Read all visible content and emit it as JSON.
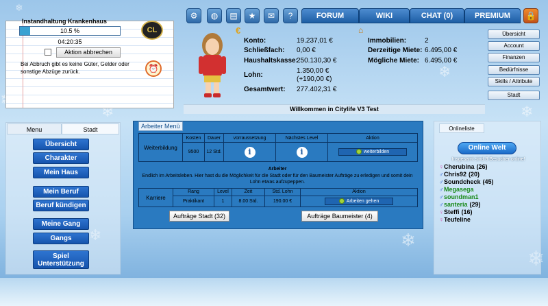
{
  "top_nav": {
    "tabs": [
      "FORUM",
      "WIKI",
      "CHAT (0)",
      "PREMIUM"
    ]
  },
  "task": {
    "title": "Instandhaltung Krankenhaus",
    "progress_text": "10.5 %",
    "progress_fraction": 0.105,
    "time_left": "04:20:35",
    "cancel_button": "Aktion abbrechen",
    "note": "Bei Abbruch gibt es keine Güter, Gelder oder sonstige Abzüge zurück.",
    "logo_text": "CL"
  },
  "status": {
    "konto_label": "Konto:",
    "konto": "19.237,01 €",
    "schliess_label": "Schließfach:",
    "schliess": "0,00 €",
    "haushalt_label": "Haushaltskasse:",
    "haushalt": "250.130,30 €",
    "lohn_label": "Lohn:",
    "lohn": "1.350,00 €",
    "lohn_extra": "(+190,00 €)",
    "gesamt_label": "Gesamtwert:",
    "gesamt": "277.402,31 €",
    "immo_label": "Immobilien:",
    "immo": "2",
    "miete_label": "Derzeitige Miete:",
    "miete": "6.495,00 €",
    "moeglich_label": "Mögliche Miete:",
    "moeglich": "6.495,00 €"
  },
  "welcome": "Willkommen in Citylife V3 Test",
  "right_menu": [
    "Übersicht",
    "Account",
    "Finanzen",
    "Bedürfnisse",
    "Skills / Attribute",
    "Stadt"
  ],
  "left_tabs": [
    "Menu",
    "Stadt"
  ],
  "left_menu": {
    "uebersicht": "Übersicht",
    "charakter": "Charakter",
    "haus": "Mein Haus",
    "beruf": "Mein Beruf",
    "kuendigen": "Beruf kündigen",
    "gang": "Meine Gang",
    "gangs": "Gangs",
    "spiel": "Spiel Unterstützung"
  },
  "arbeiter": {
    "tab": "Arbeiter Menü",
    "weiter": {
      "row_label": "Weiterbildung",
      "headers": [
        "Kosten",
        "Dauer",
        "vorraussetzung",
        "Nächstes Level",
        "Aktion"
      ],
      "kosten": "9500",
      "dauer": "12 Std.",
      "action": "weiterbilden"
    },
    "section_title": "Arbeiter",
    "section_text": "Endlich im Arbeitsleben. Hier hast du die Möglichkeit für die Stadt oder für den Baumeister Aufträge zu erledigen und somit dein Lohn etwas aufzupeppen.",
    "karriere": {
      "row_label": "Karriere",
      "headers": [
        "Rang",
        "Level",
        "Zeit",
        "Std. Lohn",
        "Aktion"
      ],
      "rang": "Praktikant",
      "level": "1",
      "zeit": "8.00 Std.",
      "lohn": "190.00 €",
      "action": "Arbeiten gehen"
    },
    "stadt_button": "Aufträge Stadt  (32)",
    "baumeister_button": "Aufträge Baumeister (4)"
  },
  "online": {
    "tab": "Onlineliste",
    "world_button": "Online Welt",
    "count_text": "Insgesamt sind 8 Besucher online!",
    "users": [
      {
        "name": "Cherubina",
        "extra": "(26)",
        "color": "#000000",
        "sym": "♀"
      },
      {
        "name": "Chris92",
        "extra": "(20)",
        "color": "#000000",
        "sym": "♂"
      },
      {
        "name": "Soundcheck",
        "extra": "(45)",
        "color": "#000000",
        "sym": "♂"
      },
      {
        "name": "Megasega",
        "extra": "",
        "color": "#1a8a1a",
        "sym": "♂"
      },
      {
        "name": "soundman1",
        "extra": "",
        "color": "#1a8a1a",
        "sym": "♂"
      },
      {
        "name": "santeria",
        "extra": "(29)",
        "color": "#1a8a1a",
        "sym": "♂"
      },
      {
        "name": "Steffi",
        "extra": "(16)",
        "color": "#000000",
        "sym": "♀"
      },
      {
        "name": "Teufeline",
        "extra": "",
        "color": "#000000",
        "sym": "♀"
      }
    ]
  }
}
